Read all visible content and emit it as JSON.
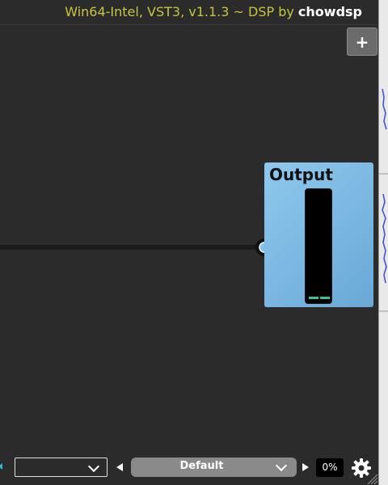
{
  "header": {
    "plugin_info": "Win64-Intel, VST3, v1.1.3 ~ DSP by ",
    "brand": "chowdsp"
  },
  "canvas": {
    "add_label": "+"
  },
  "output_node": {
    "title": "Output",
    "meter_level": 0.02
  },
  "bottom_bar": {
    "empty_select_value": "",
    "preset_name": "Default",
    "cpu_usage": "0%"
  },
  "colors": {
    "header_text": "#c8c441",
    "output_node": "#7ab9e6",
    "meter_bar": "#39c39a",
    "cable_start": "#c8c28a",
    "cable_end": "#8fcfee"
  },
  "icons": {
    "add": "plus-icon",
    "preset_prev": "triangle-left-icon",
    "preset_next": "triangle-right-icon",
    "settings": "gear-icon",
    "dropdown": "chevron-down-icon",
    "resize": "resize-grip-icon"
  }
}
